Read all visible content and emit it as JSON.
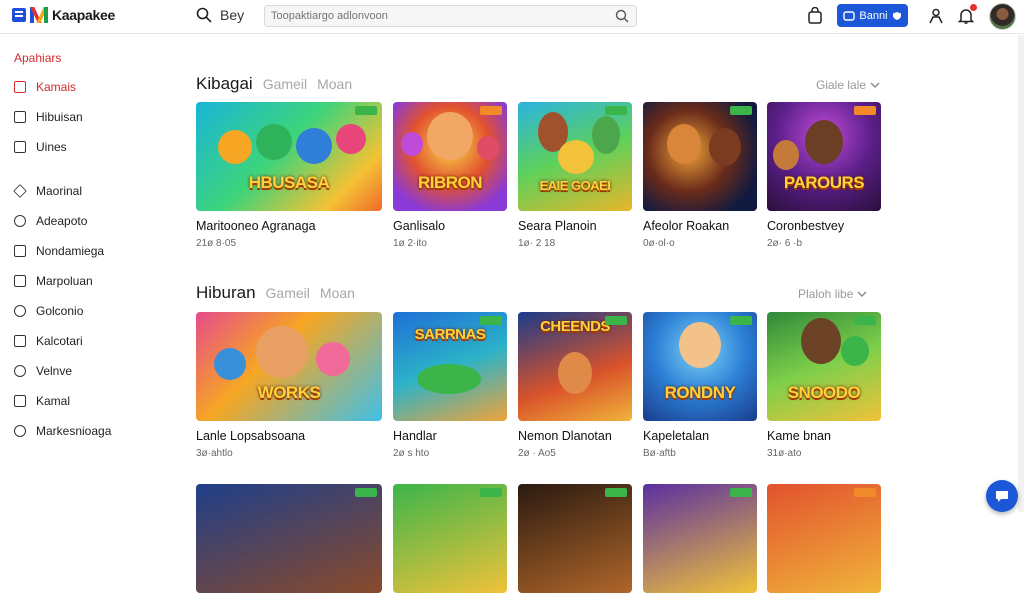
{
  "header": {
    "logo_text": "Kaapakee",
    "search_label": "Bey",
    "search_placeholder": "Toopaktiargo adlonvoon",
    "promo_button_label": "Banni",
    "icons": [
      "search-icon",
      "bag-icon",
      "user-icon",
      "bell-icon"
    ],
    "accent_color": "#1b57d6"
  },
  "sidebar": {
    "title": "Apahiars",
    "items": [
      {
        "label": "Kamais",
        "icon": "home-icon",
        "active": true
      },
      {
        "label": "Hibuisan",
        "icon": "square-icon"
      },
      {
        "label": "Uines",
        "icon": "grid-icon"
      },
      {
        "label": "Maorinal",
        "icon": "tag-icon"
      },
      {
        "label": "Adeapoto",
        "icon": "clock-icon"
      },
      {
        "label": "Nondamiega",
        "icon": "square-icon"
      },
      {
        "label": "Marpoluan",
        "icon": "image-icon"
      },
      {
        "label": "Golconio",
        "icon": "globe-icon"
      },
      {
        "label": "Kalcotari",
        "icon": "chat-icon"
      },
      {
        "label": "Velnve",
        "icon": "help-icon"
      },
      {
        "label": "Kamal",
        "icon": "square-icon"
      },
      {
        "label": "Markesnioaga",
        "icon": "info-icon"
      }
    ]
  },
  "sections": [
    {
      "title": "Kibagai",
      "tabs": [
        "Gameil",
        "Moan"
      ],
      "see_all": "Giale lale",
      "cards": [
        {
          "title": "Maritooneo Agranaga",
          "meta": "21ø 8·05",
          "logo": "HBUSASA"
        },
        {
          "title": "Ganlisalo",
          "meta": "1ø 2·ito",
          "logo": "RIBRON"
        },
        {
          "title": "Seara Planoin",
          "meta": "1ø· 2 18",
          "logo": "EAIE GOAEI"
        },
        {
          "title": "Afeolor Roakan",
          "meta": "0ø·ol·o",
          "logo": ""
        },
        {
          "title": "Coronbestvey",
          "meta": "2ø· 6 ·b",
          "logo": "PAROURS"
        }
      ]
    },
    {
      "title": "Hiburan",
      "tabs": [
        "Gameil",
        "Moan"
      ],
      "see_all": "Plaloh libe",
      "cards": [
        {
          "title": "Lanle Lopsabsoana",
          "meta": "3ø·ahtlo",
          "logo": "WORKS"
        },
        {
          "title": "Handlar",
          "meta": "2ø s hto",
          "logo": "SARRNAS"
        },
        {
          "title": "Nemon Dlanotan",
          "meta": "2ø · Ao5",
          "logo": "CHEENDS"
        },
        {
          "title": "Kapeletalan",
          "meta": "Bø·aftb",
          "logo": "RONDNY"
        },
        {
          "title": "Kame bnan",
          "meta": "31ø·ato",
          "logo": "SNOODO"
        }
      ]
    }
  ]
}
